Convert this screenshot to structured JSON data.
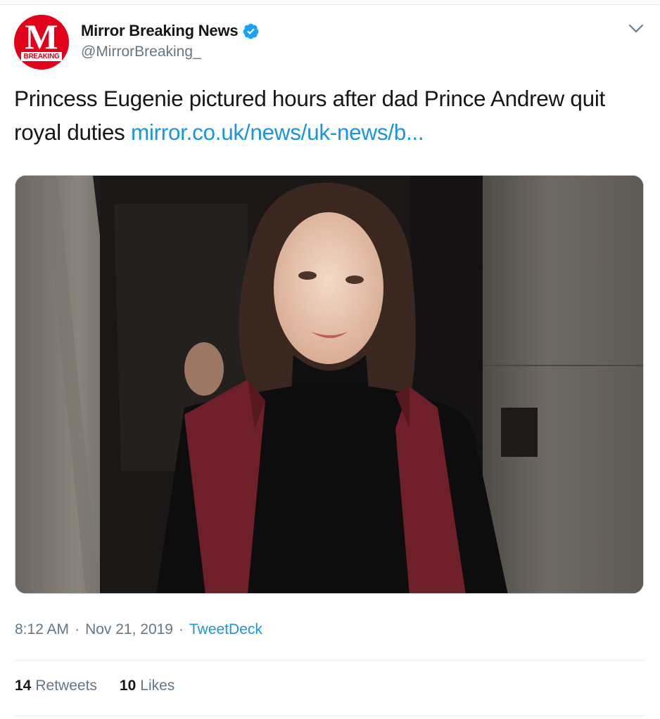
{
  "tweet": {
    "author": {
      "display_name": "Mirror Breaking News",
      "handle": "@MirrorBreaking_",
      "verified": true,
      "avatar_letter": "M",
      "avatar_tag": "BREAKING"
    },
    "text": "Princess Eugenie pictured hours after dad Prince Andrew quit royal duties",
    "link_text": "mirror.co.uk/news/uk-news/b...",
    "media_icon": "photo",
    "time": "8:12 AM",
    "date": "Nov 21, 2019",
    "source": "TweetDeck",
    "separator": "·",
    "retweets": {
      "count": "14",
      "label": "Retweets"
    },
    "likes": {
      "count": "10",
      "label": "Likes"
    }
  },
  "colors": {
    "brand_red": "#e2001a",
    "link_blue": "#1b95e0",
    "verified_blue": "#1da1f2",
    "secondary_text": "#657786",
    "primary_text": "#14171a"
  }
}
